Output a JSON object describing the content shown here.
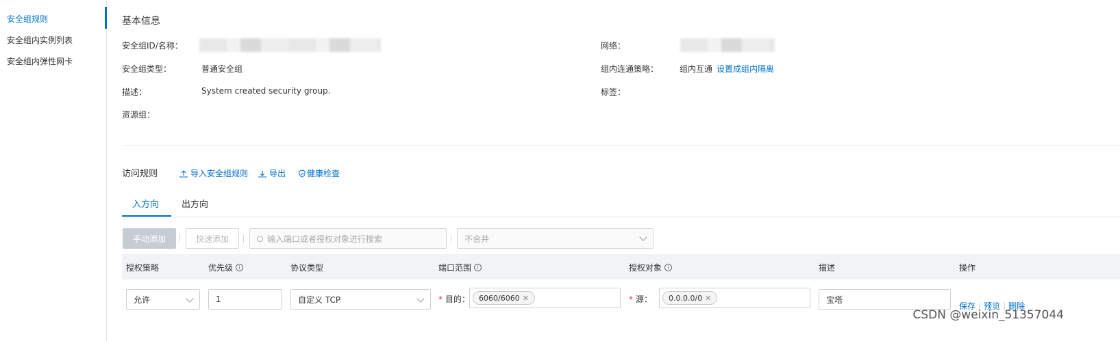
{
  "sidebar": {
    "items": [
      {
        "label": "安全组规则"
      },
      {
        "label": "安全组内实例列表"
      },
      {
        "label": "安全组内弹性网卡"
      }
    ]
  },
  "basic_info": {
    "title": "基本信息",
    "id_label": "安全组ID/名称：",
    "network_label": "网络：",
    "type_label": "安全组类型：",
    "type_value": "普通安全组",
    "policy_label": "组内连通策略：",
    "policy_value": "组内互通",
    "policy_action": "设置成组内隔离",
    "desc_label": "描述：",
    "desc_value": "System created security group.",
    "tags_label": "标签：",
    "resource_group_label": "资源组："
  },
  "rules": {
    "title": "访问规则",
    "import_label": "导入安全组规则",
    "export_label": "导出",
    "health_label": "健康检查",
    "tabs": [
      {
        "label": "入方向"
      },
      {
        "label": "出方向"
      }
    ],
    "manual_add": "手动添加",
    "quick_add": "快速添加",
    "search_placeholder": "输入端口或者授权对象进行搜索",
    "merge_placeholder": "不合并",
    "columns": {
      "policy": "授权策略",
      "priority": "优先级",
      "protocol": "协议类型",
      "port_range": "端口范围",
      "auth_object": "授权对象",
      "description": "描述",
      "actions": "操作"
    },
    "row": {
      "policy": "允许",
      "priority": "1",
      "protocol": "自定义 TCP",
      "dest_label": "目的：",
      "dest_tag": "6060/6060",
      "src_label": "源：",
      "src_tag": "0.0.0.0/0",
      "description": "宝塔",
      "save": "保存",
      "preview": "预览",
      "delete": "删除"
    }
  },
  "watermark": "CSDN @weixin_51357044",
  "colors": {
    "accent": "#0070cc",
    "required": "#e0393e"
  }
}
